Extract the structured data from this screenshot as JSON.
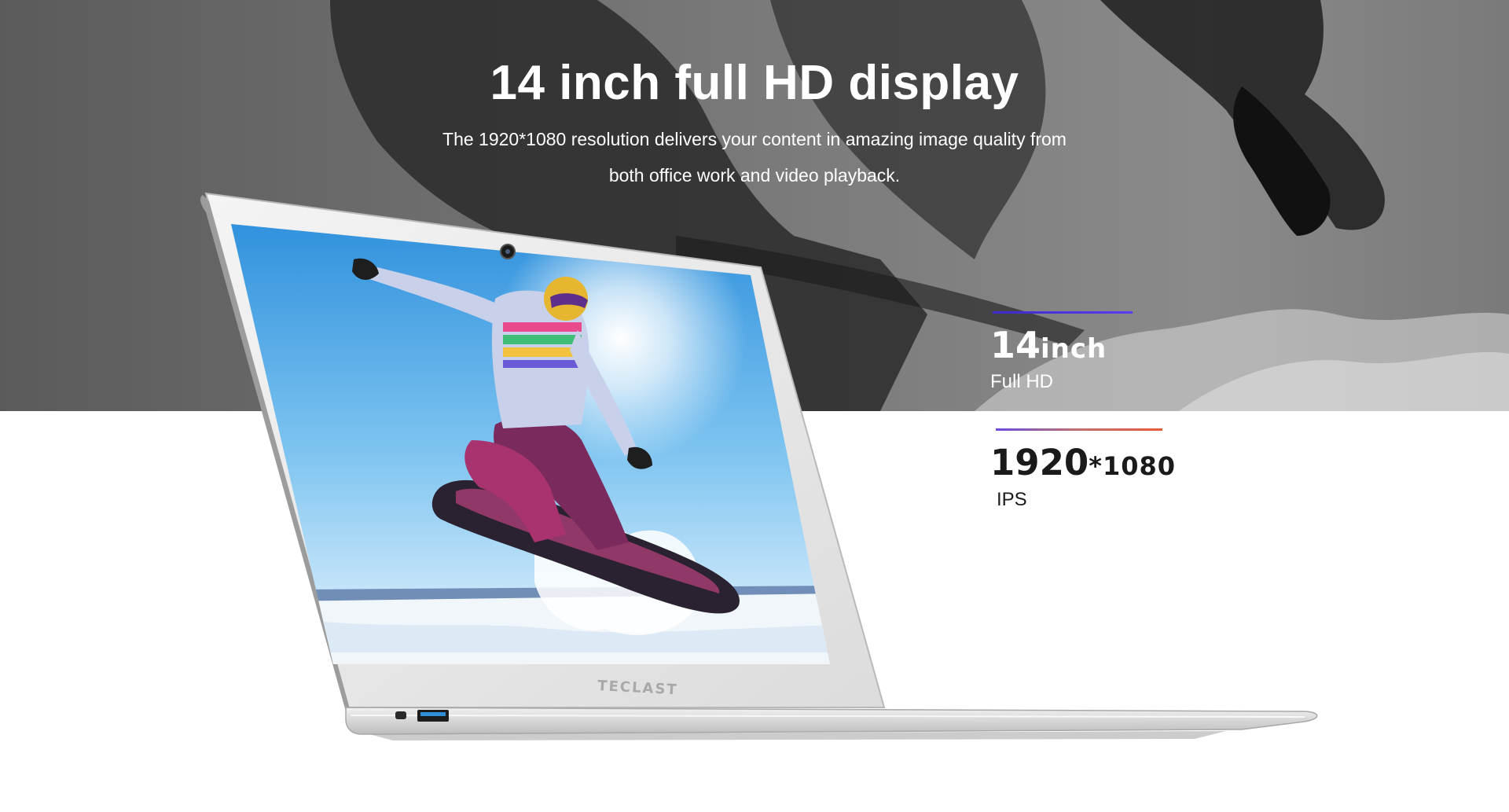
{
  "headline": "14 inch full HD display",
  "description": {
    "line1": "The 1920*1080 resolution delivers your content in amazing image quality from",
    "line2": "both office work and video playback."
  },
  "specs": [
    {
      "value": "14",
      "unit": "inch",
      "caption": "Full HD"
    },
    {
      "value": "1920",
      "unit": "*1080",
      "caption": "IPS"
    }
  ],
  "laptop": {
    "brand_logo": "TECLAST"
  },
  "colors": {
    "spec1_line": "#4a35e0",
    "spec2_line_start": "#6b4be0",
    "spec2_line_end": "#e8583e",
    "backdrop": "#6e6e6e"
  }
}
